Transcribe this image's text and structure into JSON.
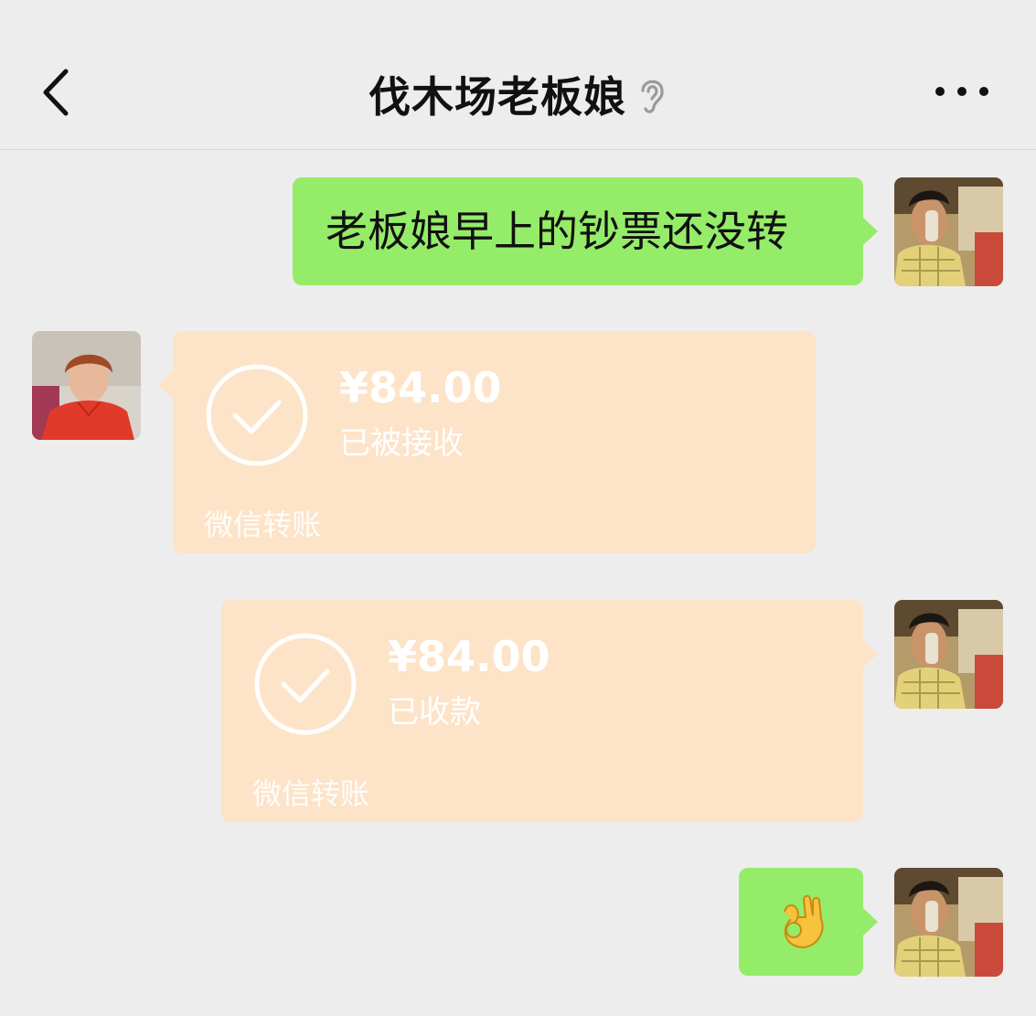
{
  "header": {
    "back_icon": "chevron-left-icon",
    "title": "伐木场老板娘",
    "muted_icon": "ear-icon",
    "more_icon": "more-dots-icon"
  },
  "messages": [
    {
      "side": "right",
      "type": "text",
      "text": "老板娘早上的钞票还没转"
    },
    {
      "side": "left",
      "type": "transfer",
      "amount": "¥84.00",
      "status": "已被接收",
      "label": "微信转账"
    },
    {
      "side": "right",
      "type": "transfer",
      "amount": "¥84.00",
      "status": "已收款",
      "label": "微信转账"
    },
    {
      "side": "right",
      "type": "emoji",
      "emoji": "ok-hand-emoji"
    }
  ],
  "colors": {
    "background": "#ededed",
    "sent_bubble": "#95ec69",
    "transfer_bubble": "#fde3c8",
    "transfer_text": "#ffffff"
  }
}
